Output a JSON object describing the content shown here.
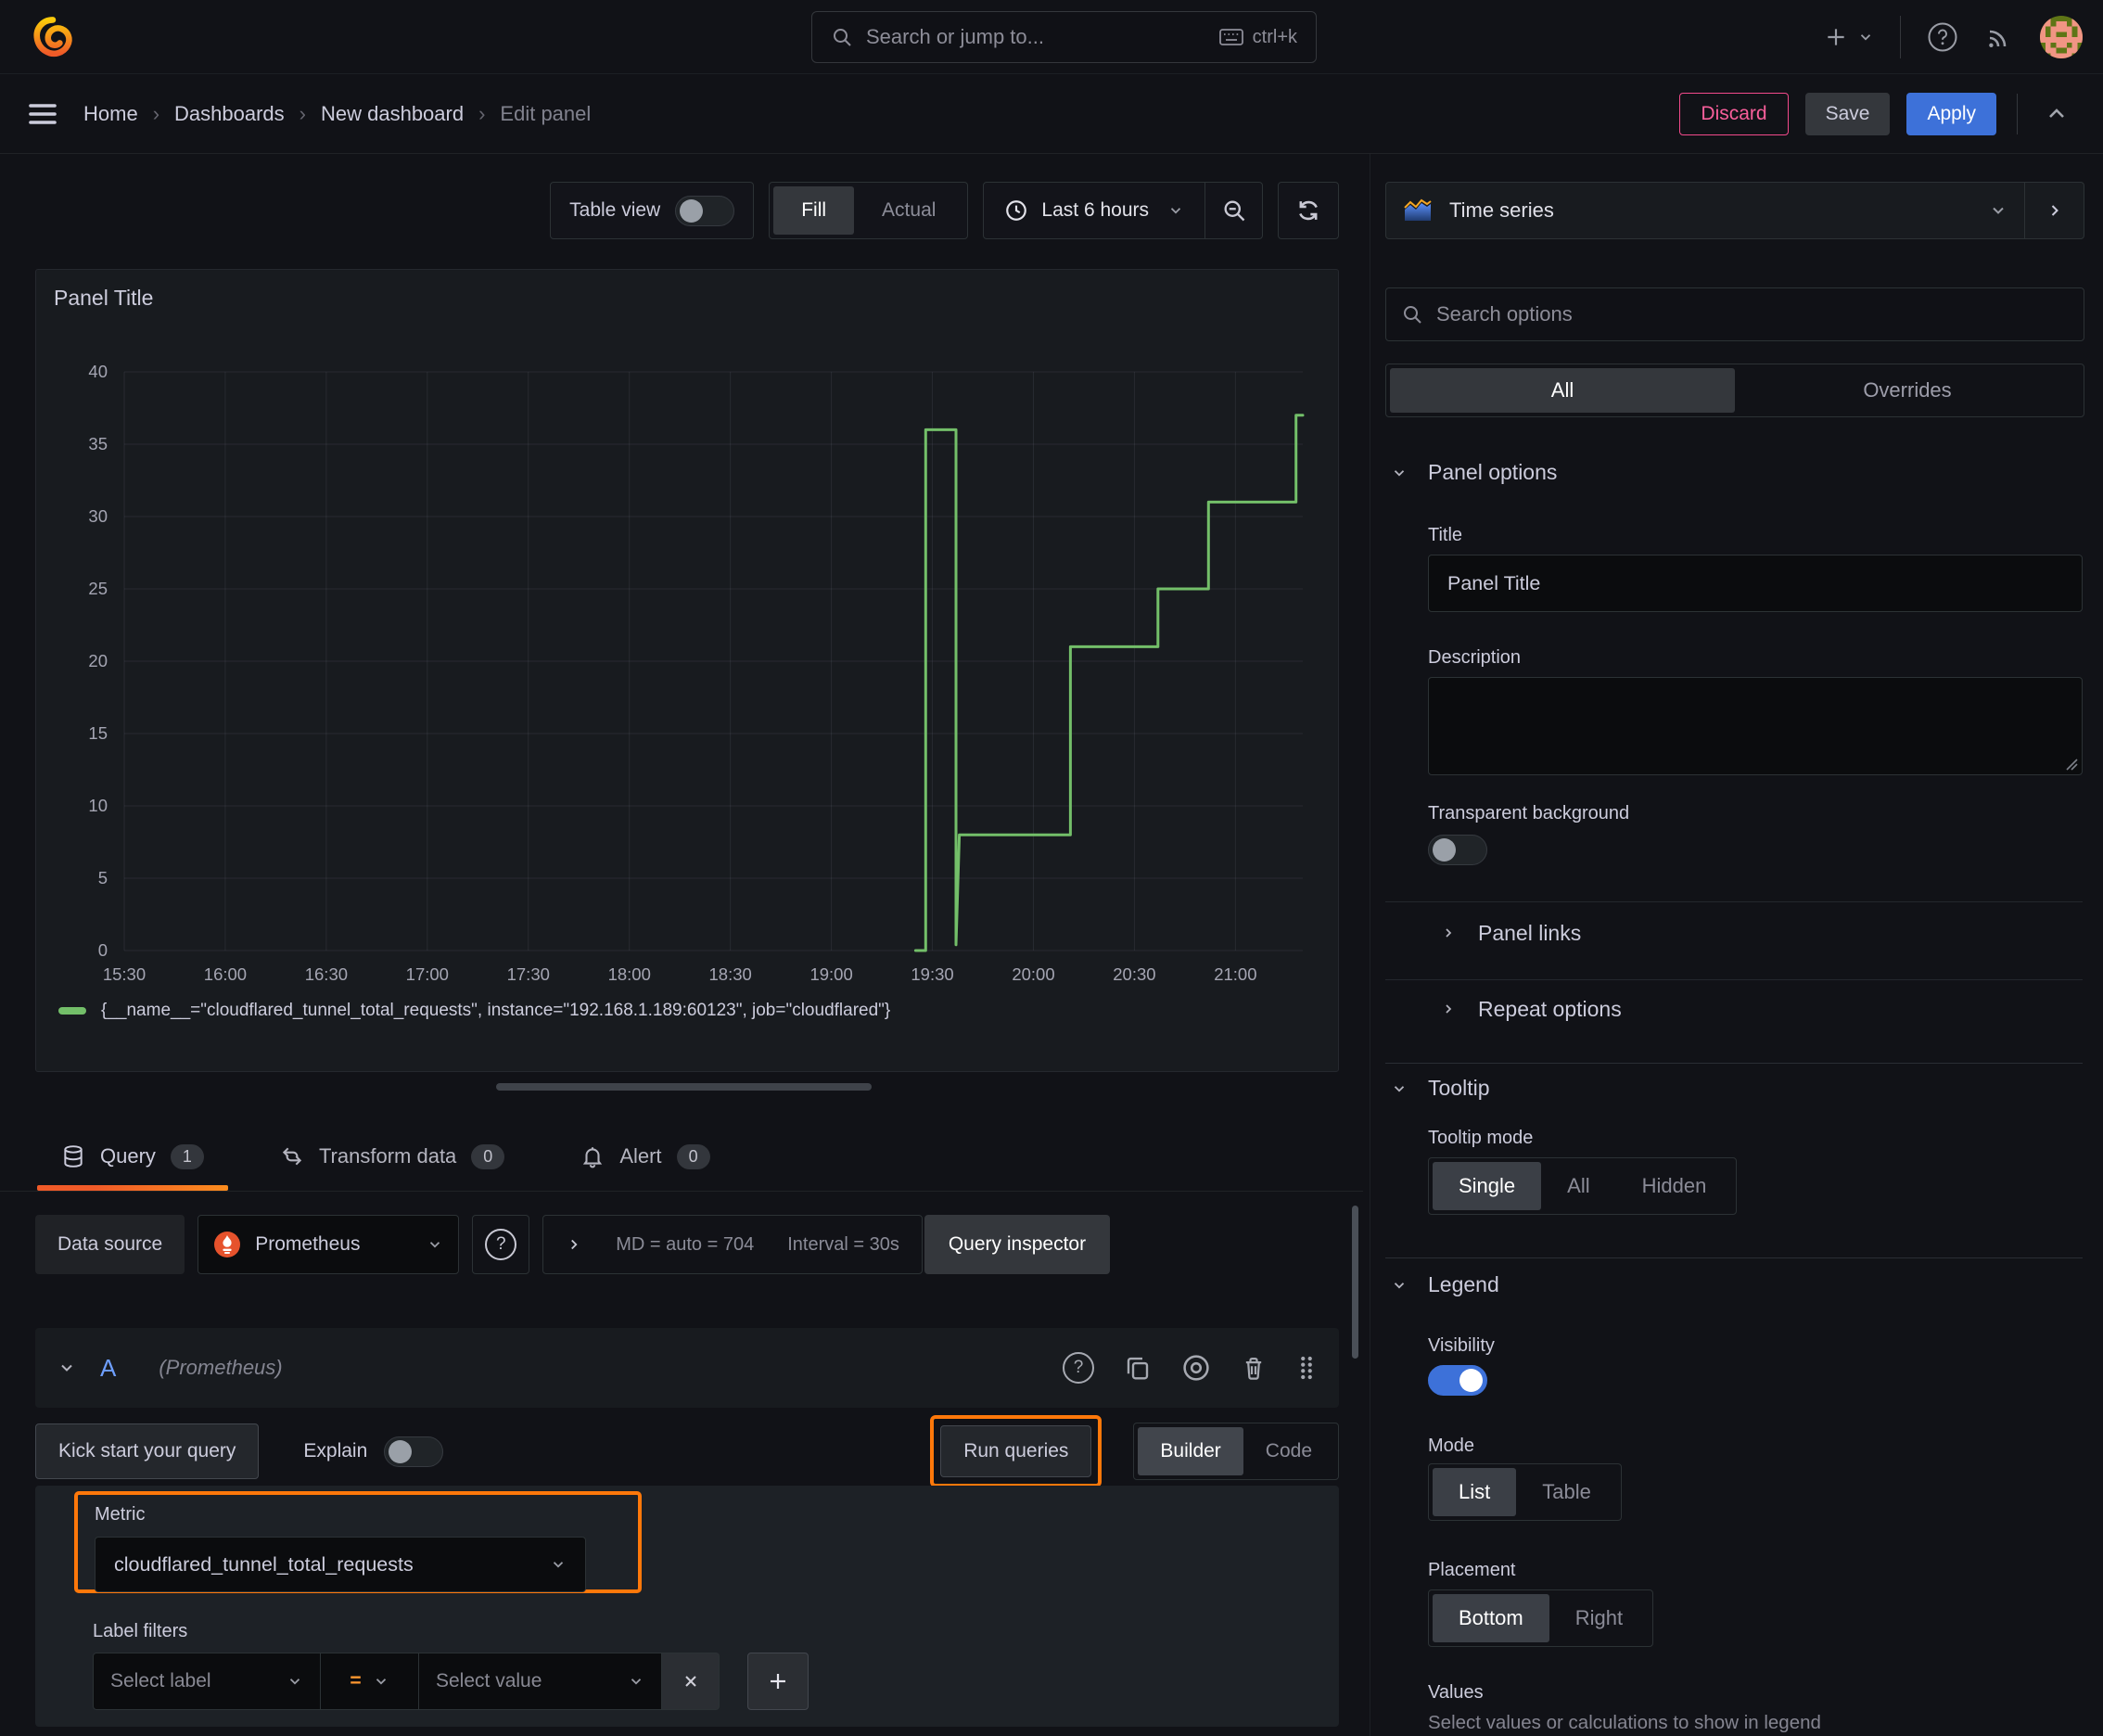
{
  "topbar": {
    "search_placeholder": "Search or jump to...",
    "search_shortcut": "ctrl+k"
  },
  "nav": {
    "breadcrumb": [
      "Home",
      "Dashboards",
      "New dashboard",
      "Edit panel"
    ],
    "discard_label": "Discard",
    "save_label": "Save",
    "apply_label": "Apply"
  },
  "panel_controls": {
    "table_view_label": "Table view",
    "fill_label": "Fill",
    "actual_label": "Actual",
    "time_range_label": "Last 6 hours"
  },
  "panel": {
    "title": "Panel Title",
    "legend_text": "{__name__=\"cloudflared_tunnel_total_requests\", instance=\"192.168.1.189:60123\", job=\"cloudflared\"}"
  },
  "chart_data": {
    "type": "line",
    "title": "Panel Title",
    "xlabel": "",
    "ylabel": "",
    "ylim": [
      0,
      40
    ],
    "y_ticks": [
      0,
      5,
      10,
      15,
      20,
      25,
      30,
      35,
      40
    ],
    "x_ticks": [
      "15:30",
      "16:00",
      "16:30",
      "17:00",
      "17:30",
      "18:00",
      "18:30",
      "19:00",
      "19:30",
      "20:00",
      "20:30",
      "21:00"
    ],
    "x_tick_minutes": [
      30,
      60,
      90,
      120,
      150,
      180,
      210,
      240,
      270,
      300,
      330,
      360
    ],
    "x_range_minutes": [
      30,
      380
    ],
    "grid": true,
    "legend_position": "bottom",
    "series": [
      {
        "name": "{__name__=\"cloudflared_tunnel_total_requests\", instance=\"192.168.1.189:60123\", job=\"cloudflared\"}",
        "color": "#73bf69",
        "step": true,
        "points": [
          [
            265,
            0
          ],
          [
            268,
            0
          ],
          [
            268,
            36
          ],
          [
            277,
            36
          ],
          [
            277,
            0.4
          ],
          [
            278,
            8
          ],
          [
            311,
            8
          ],
          [
            311,
            21
          ],
          [
            337,
            21
          ],
          [
            337,
            25
          ],
          [
            352,
            25
          ],
          [
            352,
            31
          ],
          [
            378,
            31
          ],
          [
            378,
            37
          ],
          [
            380,
            37
          ]
        ]
      }
    ]
  },
  "tabs": {
    "query_label": "Query",
    "query_count": "1",
    "transform_label": "Transform data",
    "transform_count": "0",
    "alert_label": "Alert",
    "alert_count": "0"
  },
  "datasource_row": {
    "label": "Data source",
    "value": "Prometheus",
    "max_data_points": "MD = auto = 704",
    "interval": "Interval = 30s",
    "query_inspector_label": "Query inspector"
  },
  "query": {
    "ref_id": "A",
    "datasource_hint": "(Prometheus)",
    "kick_start_label": "Kick start your query",
    "explain_label": "Explain",
    "run_queries_label": "Run queries",
    "builder_label": "Builder",
    "code_label": "Code",
    "metric_label": "Metric",
    "metric_value": "cloudflared_tunnel_total_requests",
    "label_filters_label": "Label filters",
    "select_label_placeholder": "Select label",
    "operator": "=",
    "select_value_placeholder": "Select value"
  },
  "sidebar": {
    "visualization": "Time series",
    "search_placeholder": "Search options",
    "tab_all": "All",
    "tab_overrides": "Overrides",
    "panel_options": {
      "heading": "Panel options",
      "title_label": "Title",
      "title_value": "Panel Title",
      "description_label": "Description",
      "transparent_label": "Transparent background",
      "panel_links_label": "Panel links",
      "repeat_options_label": "Repeat options"
    },
    "tooltip": {
      "heading": "Tooltip",
      "mode_label": "Tooltip mode",
      "single": "Single",
      "all": "All",
      "hidden": "Hidden"
    },
    "legend": {
      "heading": "Legend",
      "visibility_label": "Visibility",
      "mode_label": "Mode",
      "list": "List",
      "table": "Table",
      "placement_label": "Placement",
      "bottom": "Bottom",
      "right": "Right",
      "values_label": "Values",
      "values_description": "Select values or calculations to show in legend"
    }
  },
  "colors": {
    "accent_orange": "#ff780a",
    "series_green": "#73bf69",
    "primary_blue": "#3d71d9",
    "danger_pink": "#f24a8b",
    "tab_underline_start": "#f05a28",
    "tab_underline_end": "#fb8b1e"
  }
}
